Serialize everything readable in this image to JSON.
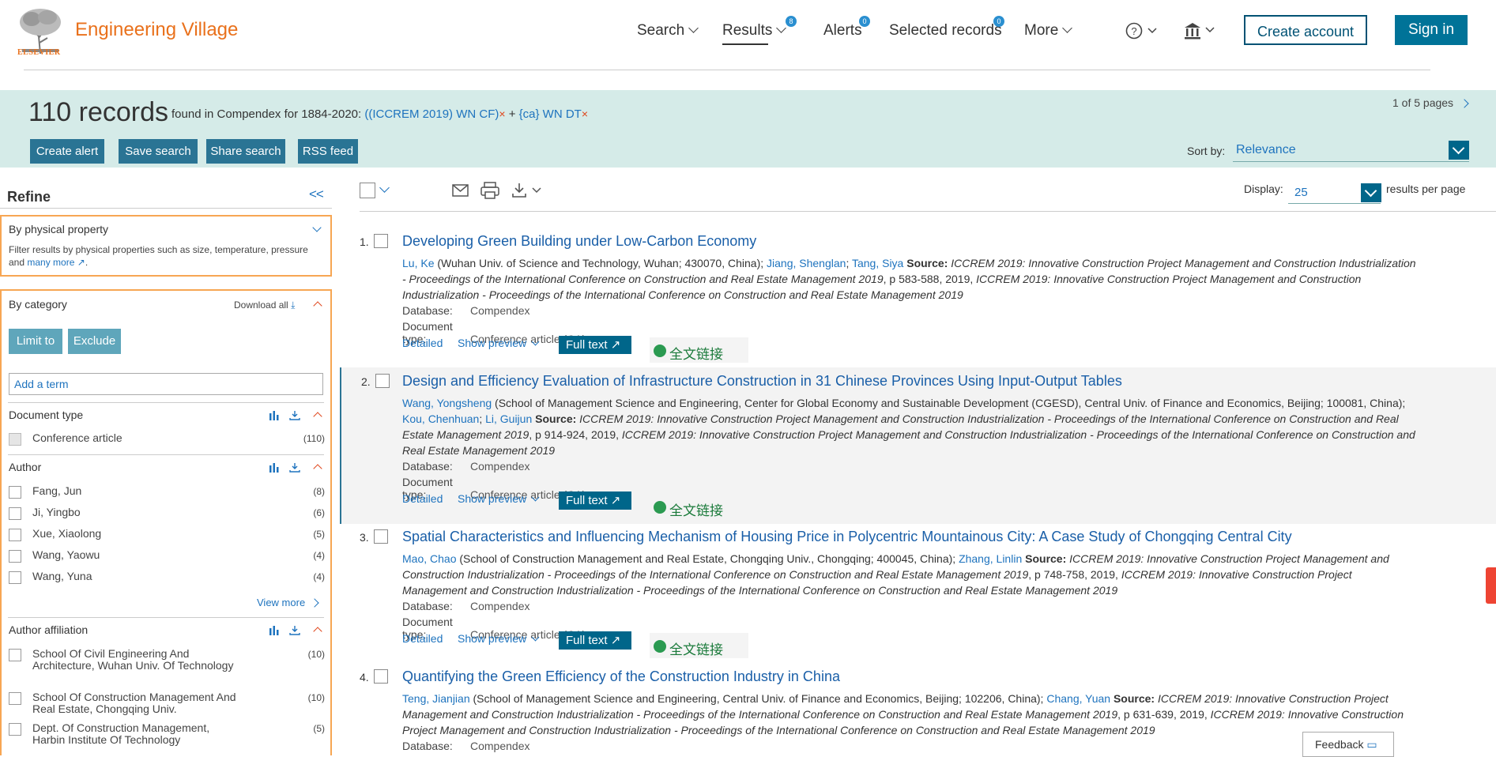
{
  "header": {
    "brand": "Engineering Village",
    "publisher": "ELSEVIER",
    "nav": [
      {
        "label": "Search"
      },
      {
        "label": "Results",
        "badge": "8"
      },
      {
        "label": "Alerts",
        "badge": "0"
      },
      {
        "label": "Selected records",
        "badge": "0"
      },
      {
        "label": "More"
      }
    ],
    "create_account": "Create account",
    "sign_in": "Sign in"
  },
  "results_bar": {
    "count": "110 records",
    "found_prefix": "found in Compendex for 1884-2020:",
    "query1": "((ICCREM 2019) WN CF)",
    "query_sep": "+",
    "query2": "{ca} WN DT",
    "remove_mark": "×",
    "page_info": "1 of 5 pages",
    "buttons": [
      "Create alert",
      "Save search",
      "Share search",
      "RSS feed"
    ],
    "sort_label": "Sort by:",
    "sort_value": "Relevance"
  },
  "sidebar": {
    "title": "Refine",
    "collapse": "<<",
    "physical": {
      "heading": "By physical property",
      "desc": "Filter results by physical properties such as size, temperature, pressure and",
      "more_link": "many more",
      "period": "."
    },
    "category": {
      "heading": "By category",
      "download_all": "Download all",
      "limit_to": "Limit to",
      "exclude": "Exclude",
      "add_term_placeholder": "Add a term"
    },
    "document_type": {
      "heading": "Document type",
      "items": [
        {
          "label": "Conference article",
          "count": "(110)"
        }
      ]
    },
    "author": {
      "heading": "Author",
      "items": [
        {
          "label": "Fang, Jun",
          "count": "(8)"
        },
        {
          "label": "Ji, Yingbo",
          "count": "(6)"
        },
        {
          "label": "Xue, Xiaolong",
          "count": "(5)"
        },
        {
          "label": "Wang, Yaowu",
          "count": "(4)"
        },
        {
          "label": "Wang, Yuna",
          "count": "(4)"
        }
      ],
      "view_more": "View more"
    },
    "affiliation": {
      "heading": "Author affiliation",
      "items": [
        {
          "label": "School Of Civil Engineering And Architecture, Wuhan Univ. Of Technology",
          "count": "(10)"
        },
        {
          "label": "School Of Construction Management And Real Estate, Chongqing Univ.",
          "count": "(10)"
        },
        {
          "label": "Dept. Of Construction Management, Harbin Institute Of Technology",
          "count": "(5)"
        }
      ]
    }
  },
  "toolbar": {
    "display_label": "Display:",
    "display_value": "25",
    "rpp_label": "results per page"
  },
  "results": [
    {
      "num": "1.",
      "title": "Developing Green Building under Low-Carbon Economy",
      "authors_html": "<span class='au'>Lu, Ke</span> (Wuhan Univ. of Science and Technology, Wuhan; 430070, China); <span class='au'>Jiang, Shenglan</span>; <span class='au'>Tang, Siya</span> <b>Source:</b> <i>ICCREM 2019: Innovative Construction Project Management and Construction Industrialization - Proceedings of the International Conference on Construction and Real Estate Management 2019</i>, p 583-588, 2019, <i>ICCREM 2019: Innovative Construction Project Management and Construction Industrialization - Proceedings of the International Conference on Construction and Real Estate Management 2019</i>",
      "database": "Compendex",
      "doctype": "Conference article (CA)"
    },
    {
      "num": "2.",
      "title": "Design and Efficiency Evaluation of Infrastructure Construction in 31 Chinese Provinces Using Input-Output Tables",
      "authors_html": "<span class='au'>Wang, Yongsheng</span> (School of Management Science and Engineering, Center for Global Economy and Sustainable Development (CGESD), Central Univ. of Finance and Economics, Beijing; 100081, China); <span class='au'>Kou, Chenhuan</span>; <span class='au'>Li, Guijun</span> <b>Source:</b> <i>ICCREM 2019: Innovative Construction Project Management and Construction Industrialization - Proceedings of the International Conference on Construction and Real Estate Management 2019</i>, p 914-924, 2019, <i>ICCREM 2019: Innovative Construction Project Management and Construction Industrialization - Proceedings of the International Conference on Construction and Real Estate Management 2019</i>",
      "database": "Compendex",
      "doctype": "Conference article (CA)"
    },
    {
      "num": "3.",
      "title": "Spatial Characteristics and Influencing Mechanism of Housing Price in Polycentric Mountainous City: A Case Study of Chongqing Central City",
      "authors_html": "<span class='au'>Mao, Chao</span> (School of Construction Management and Real Estate, Chongqing Univ., Chongqing; 400045, China); <span class='au'>Zhang, Linlin</span> <b>Source:</b> <i>ICCREM 2019: Innovative Construction Project Management and Construction Industrialization - Proceedings of the International Conference on Construction and Real Estate Management 2019</i>, p 748-758, 2019, <i>ICCREM 2019: Innovative Construction Project Management and Construction Industrialization - Proceedings of the International Conference on Construction and Real Estate Management 2019</i>",
      "database": "Compendex",
      "doctype": "Conference article (CA)"
    },
    {
      "num": "4.",
      "title": "Quantifying the Green Efficiency of the Construction Industry in China",
      "authors_html": "<span class='au'>Teng, Jianjian</span> (School of Management Science and Engineering, Central Univ. of Finance and Economics, Beijing; 102206, China); <span class='au'>Chang, Yuan</span> <b>Source:</b> <i>ICCREM 2019: Innovative Construction Project Management and Construction Industrialization - Proceedings of the International Conference on Construction and Real Estate Management 2019</i>, p 631-639, 2019, <i>ICCREM 2019: Innovative Construction Project Management and Construction Industrialization - Proceedings of the International Conference on Construction and Real Estate Management 2019</i>",
      "database": "Compendex",
      "doctype": ""
    }
  ],
  "result_labels": {
    "database": "Database:",
    "doctype": "Document type:",
    "detailed": "Detailed",
    "show_preview": "Show preview",
    "full_text": "Full text",
    "cn_link": "全文链接"
  },
  "feedback": "Feedback",
  "colors": {
    "brand": "#e9711c",
    "accent": "#00668a",
    "band": "#d5ebe8",
    "facet_border": "#f7a653"
  }
}
